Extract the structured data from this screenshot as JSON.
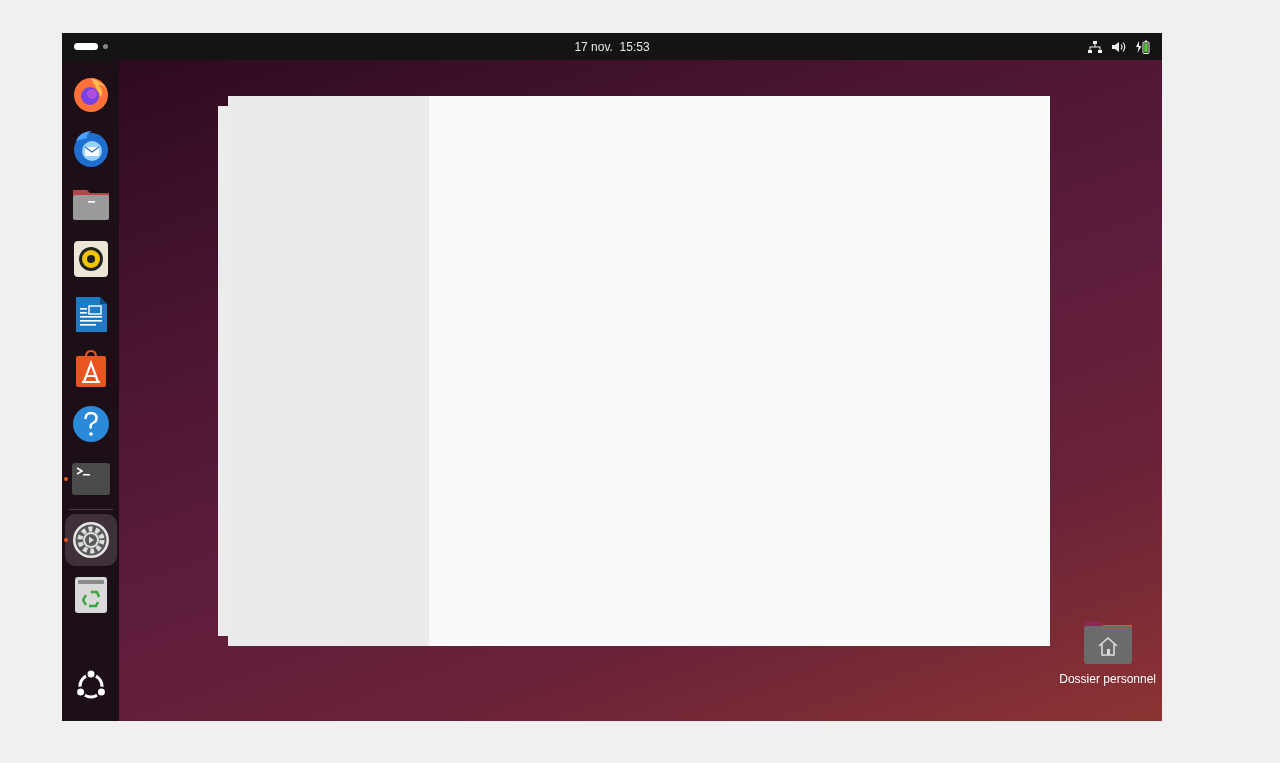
{
  "top_bar": {
    "workspaces": [
      {
        "selected": true
      },
      {
        "selected": false
      }
    ],
    "clock": "17 nov.  15:53"
  },
  "dock": {
    "items": [
      {
        "kind": "firefox",
        "running": false,
        "selected": false
      },
      {
        "kind": "thunderbird",
        "running": false,
        "selected": false
      },
      {
        "kind": "files",
        "running": false,
        "selected": false
      },
      {
        "kind": "rhythmbox",
        "running": false,
        "selected": false
      },
      {
        "kind": "writer",
        "running": false,
        "selected": false
      },
      {
        "kind": "appcenter",
        "running": false,
        "selected": false
      },
      {
        "kind": "help",
        "running": false,
        "selected": false
      },
      {
        "kind": "terminal",
        "running": true,
        "selected": false
      },
      {
        "kind": "settings",
        "running": true,
        "selected": true
      },
      {
        "kind": "trash",
        "running": false,
        "selected": false
      }
    ]
  },
  "desktop_icons": [
    {
      "label": "Dossier personnel"
    }
  ]
}
